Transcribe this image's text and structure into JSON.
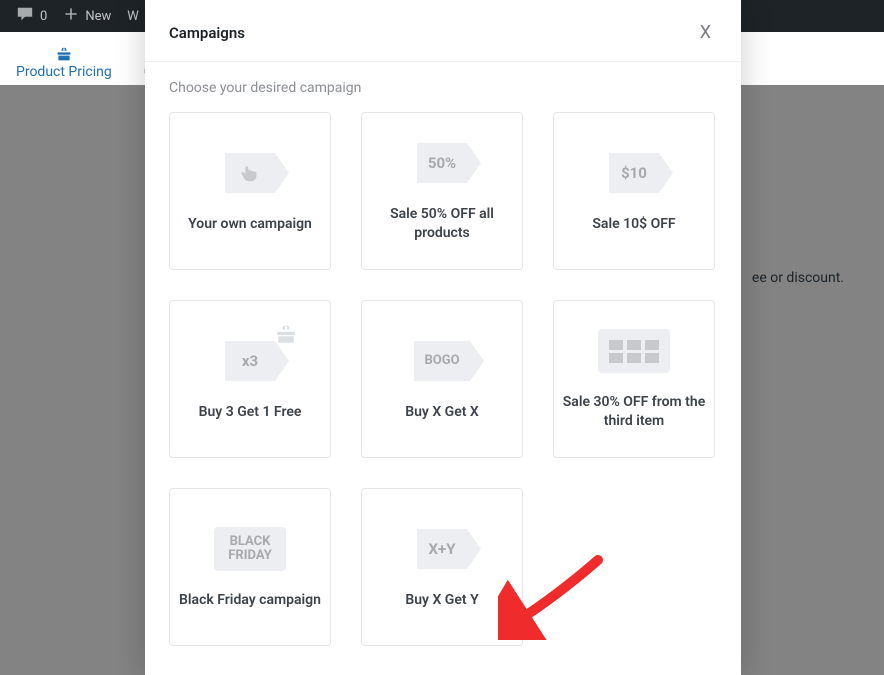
{
  "admin_bar": {
    "comment_count": "0",
    "new_label": "New",
    "extra_label": "W"
  },
  "tabs": {
    "active_icon": "gift",
    "active_label": "Product Pricing",
    "second_label": "C"
  },
  "background_text": "ee or discount.",
  "modal": {
    "title": "Campaigns",
    "close_glyph": "X",
    "subtitle": "Choose your desired campaign",
    "cards": [
      {
        "icon_type": "hand",
        "icon_text": "",
        "label": "Your own campaign"
      },
      {
        "icon_type": "tag",
        "icon_text": "50%",
        "label": "Sale 50% OFF all products"
      },
      {
        "icon_type": "tag",
        "icon_text": "$10",
        "label": "Sale 10$ OFF"
      },
      {
        "icon_type": "gift",
        "icon_text": "x3",
        "label": "Buy 3 Get 1 Free"
      },
      {
        "icon_type": "tag",
        "icon_text": "BOGO",
        "label": "Buy X Get X"
      },
      {
        "icon_type": "blocks",
        "icon_text": "",
        "label": "Sale 30% OFF from the third item"
      },
      {
        "icon_type": "sq",
        "icon_text": "BLACK FRIDAY",
        "label": "Black Friday campaign"
      },
      {
        "icon_type": "tag",
        "icon_text": "X+Y",
        "label": "Buy X Get Y"
      }
    ]
  },
  "arrow_color": "#ef2b2b"
}
